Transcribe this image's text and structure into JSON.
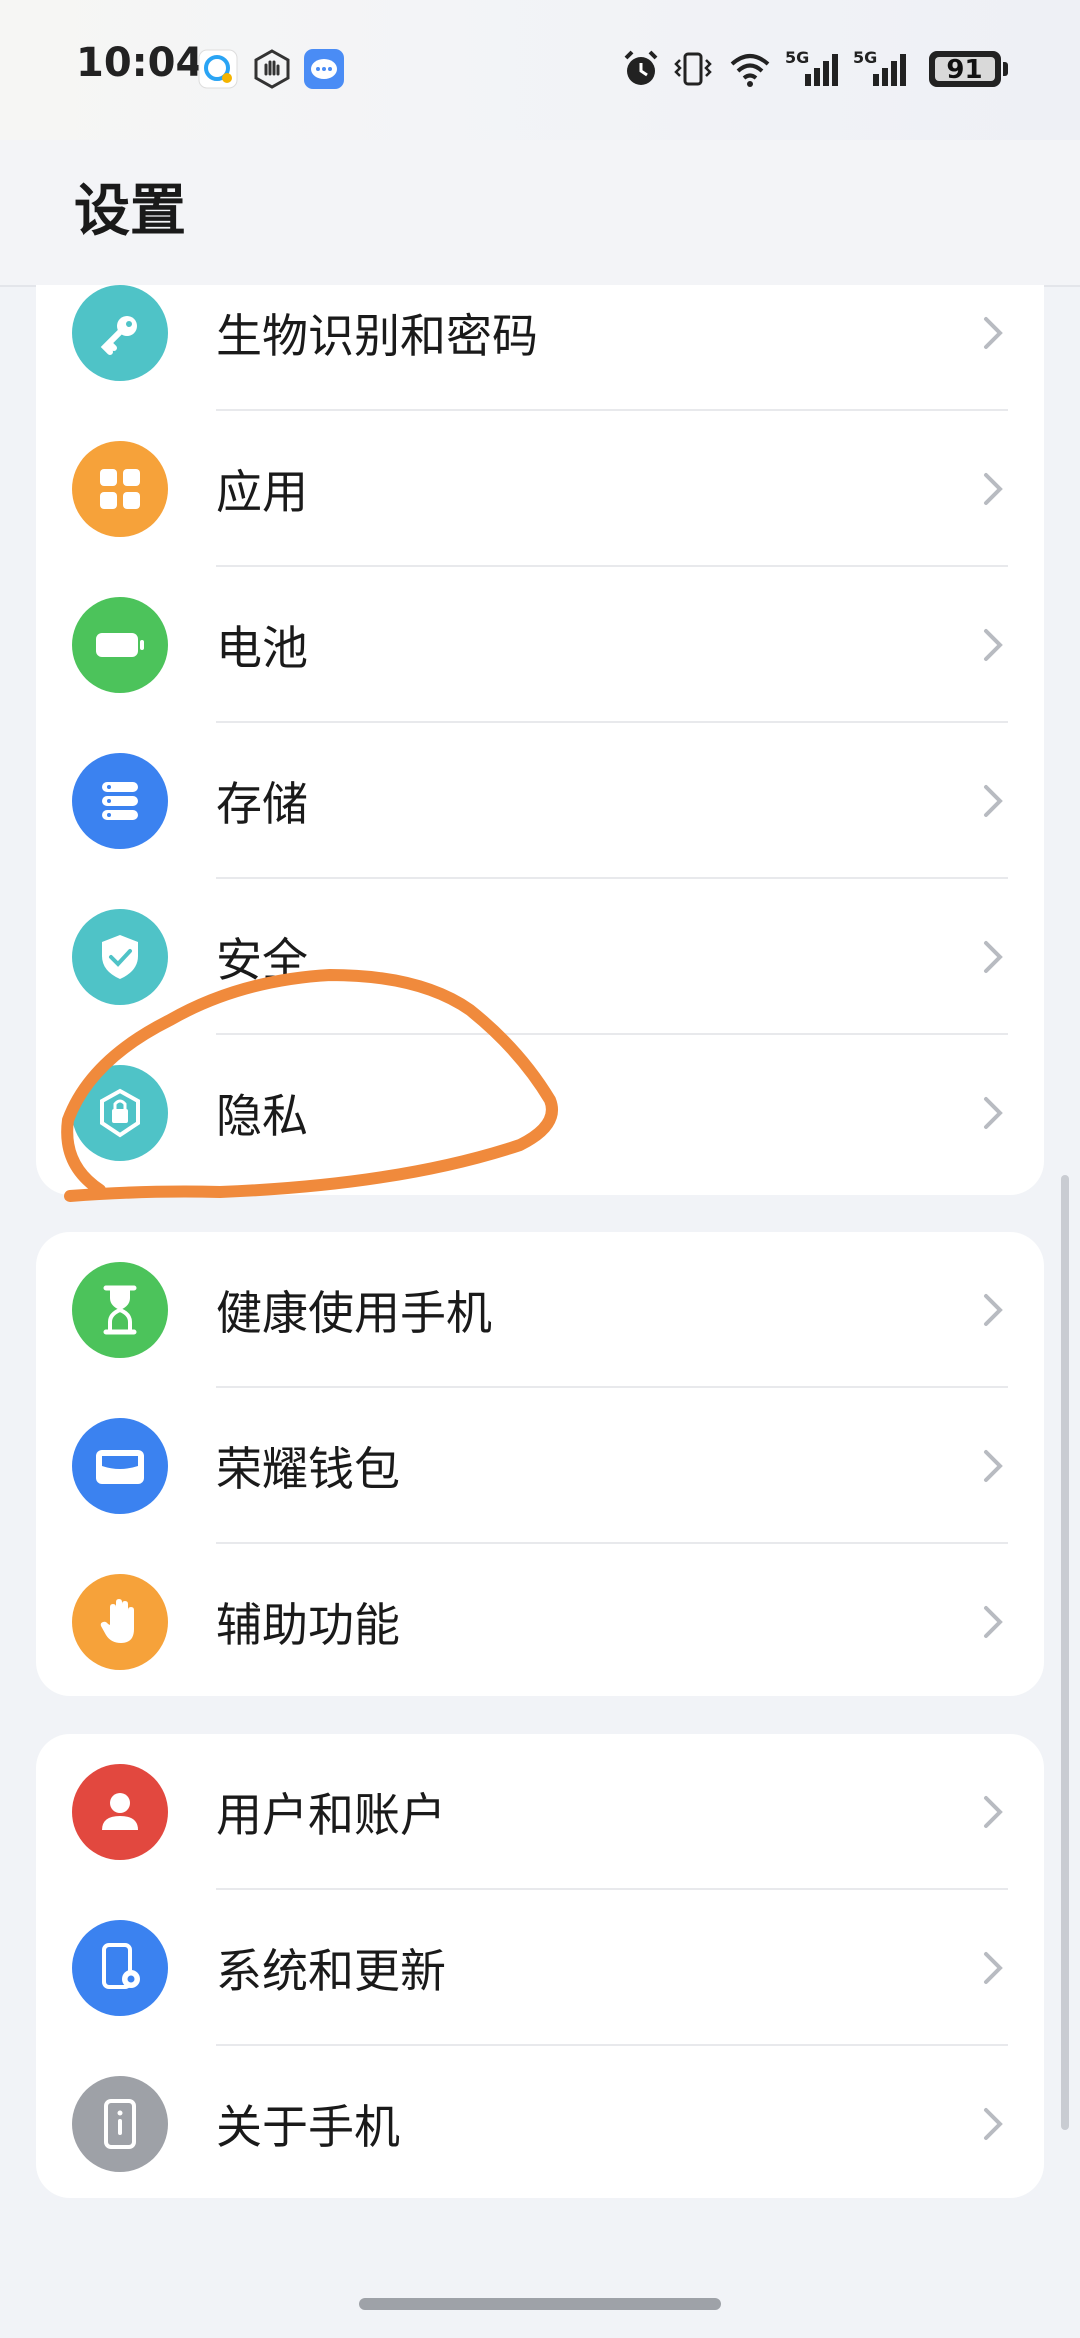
{
  "status_bar": {
    "time": "10:04",
    "battery_level": "91",
    "network_1": "5G",
    "network_2": "5G",
    "icons": [
      "chat-bubble-icon",
      "hand-icon",
      "message-icon",
      "alarm-icon",
      "vibrate-icon",
      "wifi-icon",
      "signal-icon",
      "signal-icon",
      "battery-icon"
    ]
  },
  "header": {
    "title": "设置"
  },
  "groups": [
    {
      "items": [
        {
          "label": "生物识别和密码",
          "icon": "key-icon",
          "color": "#4fc3c7"
        },
        {
          "label": "应用",
          "icon": "apps-grid-icon",
          "color": "#f6a23a"
        },
        {
          "label": "电池",
          "icon": "battery-icon",
          "color": "#4cc35b"
        },
        {
          "label": "存储",
          "icon": "storage-icon",
          "color": "#3b82f0"
        },
        {
          "label": "安全",
          "icon": "shield-icon",
          "color": "#4fc3c7"
        },
        {
          "label": "隐私",
          "icon": "privacy-lock-icon",
          "color": "#4fc3c7"
        }
      ]
    },
    {
      "items": [
        {
          "label": "健康使用手机",
          "icon": "hourglass-icon",
          "color": "#4cc35b"
        },
        {
          "label": "荣耀钱包",
          "icon": "wallet-icon",
          "color": "#3b82f0"
        },
        {
          "label": "辅助功能",
          "icon": "hand-icon",
          "color": "#f6a23a"
        }
      ]
    },
    {
      "items": [
        {
          "label": "用户和账户",
          "icon": "user-icon",
          "color": "#e2483f"
        },
        {
          "label": "系统和更新",
          "icon": "system-update-icon",
          "color": "#3b82f0"
        },
        {
          "label": "关于手机",
          "icon": "phone-info-icon",
          "color": "#9ea1a7"
        }
      ]
    }
  ],
  "annotation": {
    "color": "#f08a3c",
    "target": "隐私"
  }
}
